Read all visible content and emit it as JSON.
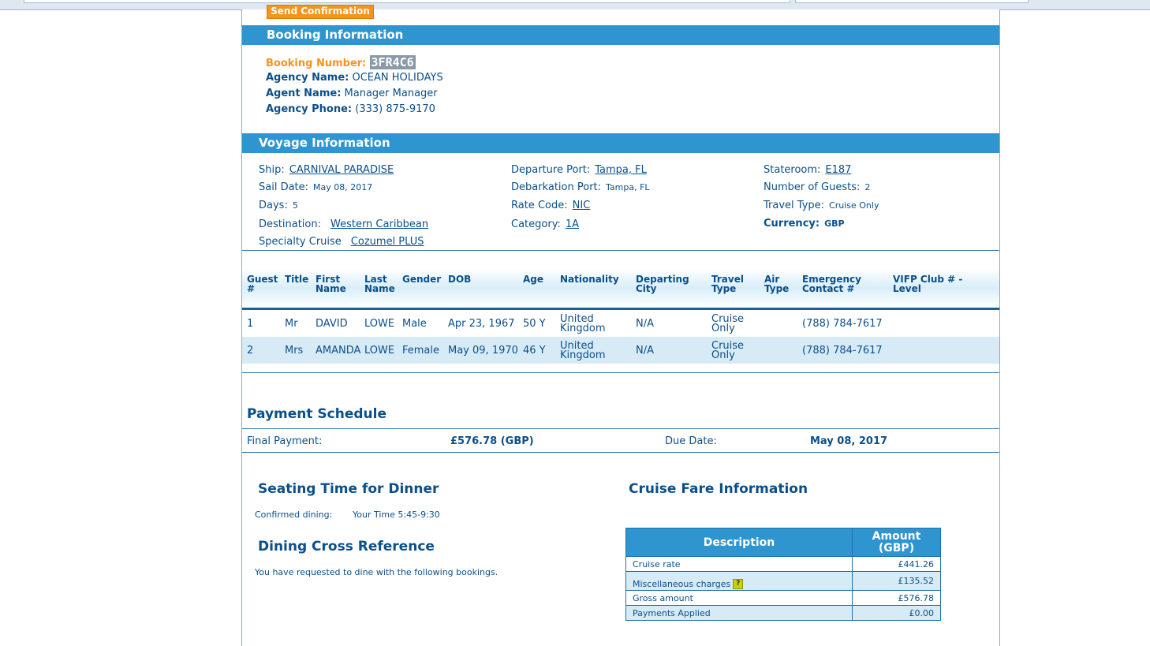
{
  "buttons": {
    "send_confirmation": "Send Confirmation"
  },
  "booking": {
    "title": "Booking Information",
    "number_label": "Booking Number:",
    "number": "3FR4C6",
    "agency_name_label": "Agency Name:",
    "agency_name": "OCEAN HOLIDAYS",
    "agent_name_label": "Agent Name:",
    "agent_name": "Manager Manager",
    "agency_phone_label": "Agency Phone:",
    "agency_phone": "(333) 875-9170"
  },
  "voyage": {
    "title": "Voyage Information",
    "ship_label": "Ship:",
    "ship": "CARNIVAL PARADISE",
    "sail_date_label": "Sail Date:",
    "sail_date": "May 08, 2017",
    "days_label": "Days:",
    "days": "5",
    "destination_label": "Destination:",
    "destination": "Western Caribbean",
    "specialty_label": "Specialty Cruise",
    "specialty": "Cozumel PLUS",
    "departure_port_label": "Departure Port:",
    "departure_port": "Tampa, FL",
    "debarkation_port_label": "Debarkation Port:",
    "debarkation_port": "Tampa, FL",
    "rate_code_label": "Rate Code:",
    "rate_code": "NIC",
    "category_label": "Category:",
    "category": "1A",
    "stateroom_label": "Stateroom:",
    "stateroom": "E187",
    "guests_label": "Number of Guests:",
    "guests": "2",
    "travel_type_label": "Travel Type:",
    "travel_type": "Cruise Only",
    "currency_label": "Currency:",
    "currency": "GBP"
  },
  "guests": {
    "headers": {
      "num_1": "Guest",
      "num_2": "#",
      "title": "Title",
      "first_1": "First",
      "first_2": "Name",
      "last_1": "Last",
      "last_2": "Name",
      "gender": "Gender",
      "dob": "DOB",
      "age": "Age",
      "nationality": "Nationality",
      "dep_1": "Departing",
      "dep_2": "City",
      "travel_1": "Travel",
      "travel_2": "Type",
      "air_1": "Air",
      "air_2": "Type",
      "emerg_1": "Emergency",
      "emerg_2": "Contact #",
      "vifp_1": "VIFP Club # -",
      "vifp_2": "Level"
    },
    "rows": [
      {
        "num": "1",
        "title": "Mr",
        "first": "DAVID",
        "last": "LOWE",
        "gender": "Male",
        "dob": "Apr 23, 1967",
        "age": "50 Y",
        "nat_1": "United",
        "nat_2": "Kingdom",
        "dep_city": "N/A",
        "travel_1": "Cruise",
        "travel_2": "Only",
        "emergency": "(788) 784-7617"
      },
      {
        "num": "2",
        "title": "Mrs",
        "first": "AMANDA",
        "last": "LOWE",
        "gender": "Female",
        "dob": "May 09, 1970",
        "age": "46 Y",
        "nat_1": "United",
        "nat_2": "Kingdom",
        "dep_city": "N/A",
        "travel_1": "Cruise",
        "travel_2": "Only",
        "emergency": "(788) 784-7617"
      }
    ]
  },
  "payment": {
    "title": "Payment Schedule",
    "final_label": "Final Payment:",
    "final_amount": "£576.78 (GBP)",
    "due_label": "Due Date:",
    "due_date": "May 08, 2017"
  },
  "dining": {
    "seating_title": "Seating Time for Dinner",
    "confirmed_label": "Confirmed dining:",
    "your_time": "Your Time 5:45-9:30",
    "cross_title": "Dining Cross Reference",
    "cross_text": "You have requested to dine with the following bookings."
  },
  "fare": {
    "title": "Cruise Fare Information",
    "col_desc": "Description",
    "col_amt_1": "Amount",
    "col_amt_2": "(GBP)",
    "rows": [
      {
        "desc": "Cruise rate",
        "amount": "£441.26"
      },
      {
        "desc": "Miscellaneous charges",
        "amount": "£135.52"
      },
      {
        "desc": "Gross amount",
        "amount": "£576.78"
      },
      {
        "desc": "Payments Applied",
        "amount": "£0.00"
      }
    ]
  }
}
